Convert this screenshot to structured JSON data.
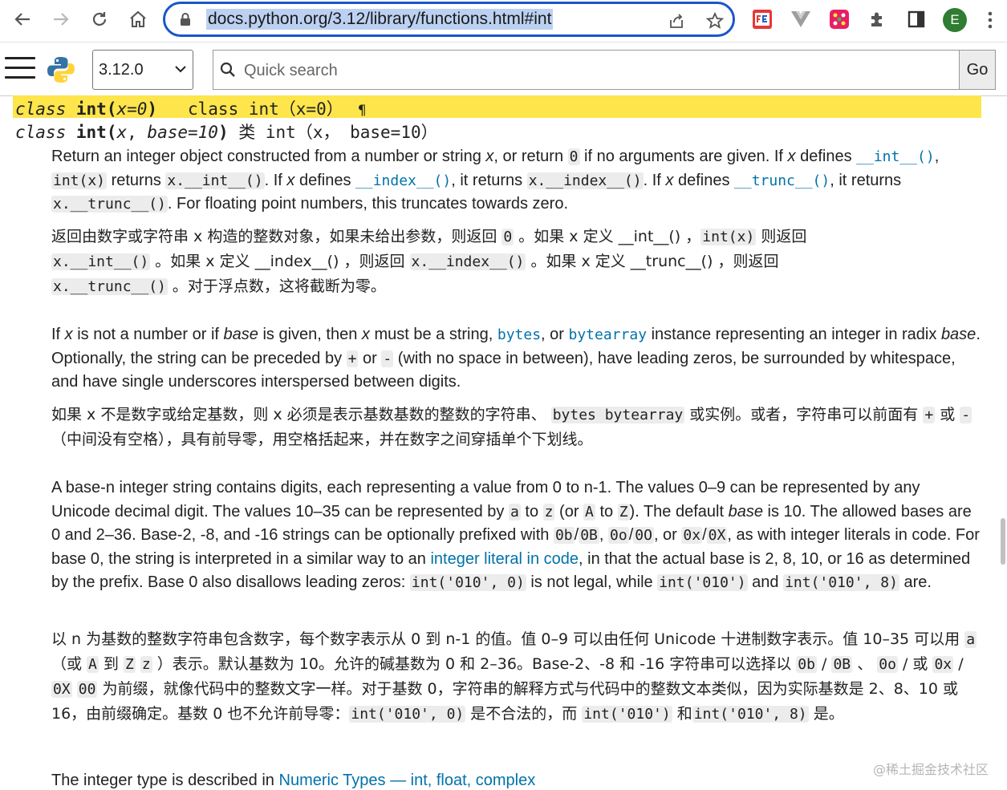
{
  "browser": {
    "url": "docs.python.org/3.12/library/functions.html#int"
  },
  "docs_header": {
    "version": "3.12.0",
    "search_placeholder": "Quick search",
    "go_label": "Go"
  },
  "avatar_letter": "E",
  "signature1": {
    "keyword": "class",
    "name": "int",
    "args": "x=0",
    "close": ")",
    "zh": "class int（x=0）",
    "pilcrow": "¶"
  },
  "signature2": {
    "keyword": "class",
    "name": "int",
    "arg1": "x",
    "arg2": "base=10",
    "zh": "类 int（x， base=10）"
  },
  "p1": {
    "t1": "Return an integer object constructed from a number or string ",
    "x": "x",
    "t2": ", or return ",
    "c0": "0",
    "t3": " if no arguments are given. If ",
    "t4": " defines ",
    "l_int": "__int__()",
    "t5": ", ",
    "c_intx": "int(x)",
    "t6": " returns ",
    "c_xint": "x.__int__()",
    "t7": ". If ",
    "l_index": "__index__()",
    "t8": ", it returns ",
    "c_xindex": "x.__index__()",
    "l_trunc": "__trunc__()",
    "c_xtrunc": "x.__trunc__()",
    "t9": ". For floating point numbers, this truncates towards zero."
  },
  "p1zh": {
    "t1": "返回由数字或字符串 x 构造的整数对象，如果未给出参数，则返回 ",
    "c0": "0",
    "t2": " 。如果 x 定义 __int__() ，",
    "c_intx": "int(x)",
    "t3": " 则返回",
    "c_xint": "x.__int__()",
    "t4": " 。如果 x 定义 __index__() ，则返回 ",
    "c_xindex": "x.__index__()",
    "t5": " 。如果 x 定义 __trunc__() ，则返回",
    "c_xtrunc": "x.__trunc__()",
    "t6": " 。对于浮点数，这将截断为零。"
  },
  "p2": {
    "t1": "If ",
    "x": "x",
    "t2": " is not a number or if ",
    "base": "base",
    "t3": " is given, then ",
    "t4": " must be a string, ",
    "l_bytes": "bytes",
    "t5": ", or ",
    "l_bytearray": "bytearray",
    "t6": " instance representing an integer in radix ",
    "t7": ". Optionally, the string can be preceded by ",
    "c_plus": "+",
    "t8": " or ",
    "c_minus": "-",
    "t9": " (with no space in between), have leading zeros, be surrounded by whitespace, and have single underscores interspersed between digits."
  },
  "p2zh": {
    "t1": "如果 x 不是数字或给定基数，则 x 必须是表示基数基数的整数的字符串、 ",
    "c_bytes": "bytes bytearray",
    "t2": " 或实例。或者，字符串可以前面有 ",
    "c_plus": "+",
    "t3": " 或 ",
    "c_minus": "-",
    "t4": " （中间没有空格），具有前导零，用空格括起来，并在数字之间穿插单个下划线。"
  },
  "p3": {
    "t1": "A base-n integer string contains digits, each representing a value from 0 to n-1. The values 0–9 can be represented by any Unicode decimal digit. The values 10–35 can be represented by ",
    "c_a": "a",
    "to": " to ",
    "c_z": "z",
    "t2": " (or ",
    "c_A": "A",
    "c_Z": "Z",
    "t3": "). The default ",
    "base": "base",
    "t4": " is 10. The allowed bases are 0 and 2–36. Base-2, -8, and -16 strings can be optionally prefixed with ",
    "c_0b": "0b",
    "slash": "/",
    "c_0B": "0B",
    "comma": ", ",
    "c_0o": "0o",
    "c_0O": "0O",
    "or": ", or ",
    "c_0x": "0x",
    "c_0X": "0X",
    "t5": ", as with integer literals in code. For base 0, the string is interpreted in a similar way to an ",
    "l_literal": "integer literal in code",
    "t6": ", in that the actual base is 2, 8, 10, or 16 as determined by the prefix. Base 0 also disallows leading zeros: ",
    "c_int010_0": "int('010', 0)",
    "t7": " is not legal, while ",
    "c_int010": "int('010')",
    "t8": " and ",
    "c_int010_8": "int('010', 8)",
    "t9": " are."
  },
  "p3zh": {
    "t1": "以 n 为基数的整数字符串包含数字，每个数字表示从 0 到 n-1 的值。值 0–9 可以由任何 Unicode 十进制数字表示。值 10–35 可以用 ",
    "c_a": "a",
    "t2": "（或 ",
    "c_A": "A",
    "t3": " 到 ",
    "c_Z": "Z",
    "c_z": "z",
    "t4": " ）表示。默认基数为 10。允许的碱基数为 0 和 2–36。Base-2、-8 和 -16 字符串可以选择以 ",
    "c_0b": "0b",
    "t5": " / ",
    "c_0B": "0B",
    "t6": " 、 ",
    "c_0o": "0o",
    "t7": " / 或 ",
    "c_0x": "0x",
    "t8": " / ",
    "c_0X": "0X",
    "c_00": "00",
    "t9": " 为前缀，就像代码中的整数文字一样。对于基数 0，字符串的解释方式与代码中的整数文本类似，因为实际基数是 2、8、10 或 16，由前缀确定。基数 0 也不允许前导零：",
    "c_int010_0": "int('010', 0)",
    "t10": " 是不合法的，而 ",
    "c_int010": "int('010')",
    "t11": " 和",
    "c_int010_8": "int('010', 8)",
    "t12": " 是。"
  },
  "cutoff": {
    "t1": "The integer type is described in ",
    "l1": "Numeric Types — int, float, complex"
  },
  "watermark": "@稀土掘金技术社区"
}
